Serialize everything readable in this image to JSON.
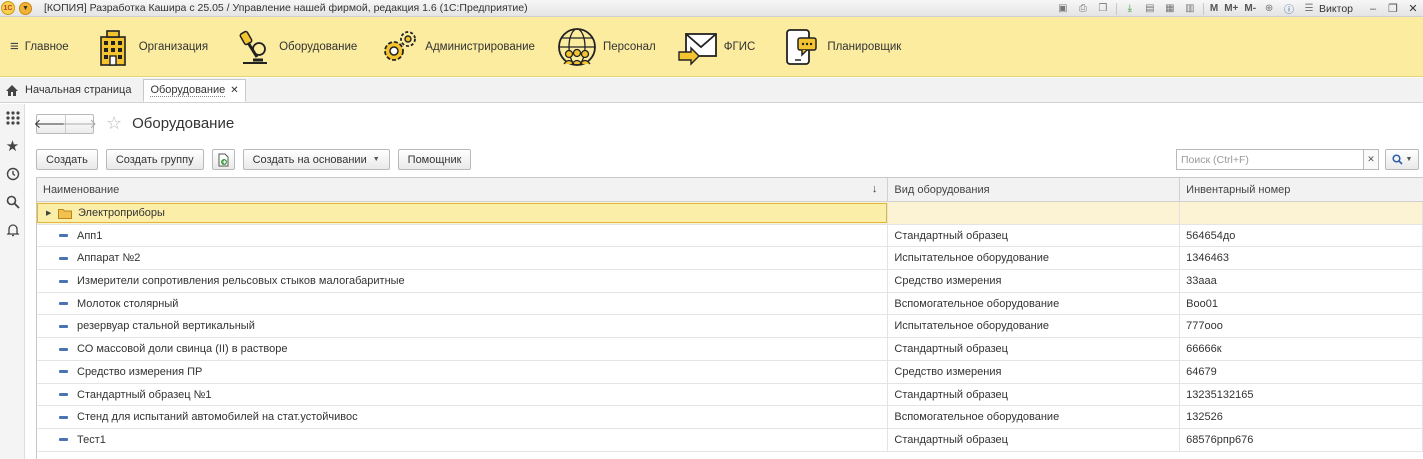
{
  "window": {
    "logo_text": "1С",
    "title": "[КОПИЯ] Разработка Кашира с 25.05 / Управление нашей фирмой, редакция 1.6  (1С:Предприятие)",
    "tools": {
      "m": "M",
      "m_plus": "M+",
      "m_minus": "M-"
    },
    "user": "Виктор"
  },
  "sections": {
    "main_label": "Главное",
    "items": [
      {
        "label": "Организация",
        "icon": "building-icon"
      },
      {
        "label": "Оборудование",
        "icon": "microscope-icon"
      },
      {
        "label": "Администрирование",
        "icon": "gears-icon"
      },
      {
        "label": "Персонал",
        "icon": "people-globe-icon"
      },
      {
        "label": "ФГИС",
        "icon": "mail-icon"
      },
      {
        "label": "Планировщик",
        "icon": "phone-chat-icon"
      }
    ]
  },
  "tabs": {
    "home": "Начальная страница",
    "active": "Оборудование"
  },
  "form": {
    "title": "Оборудование",
    "toolbar": {
      "create": "Создать",
      "create_group": "Создать группу",
      "create_based_on": "Создать на основании",
      "helper": "Помощник"
    },
    "search": {
      "placeholder": "Поиск (Ctrl+F)",
      "value": ""
    }
  },
  "table": {
    "columns": [
      "Наименование",
      "Вид оборудования",
      "Инвентарный номер"
    ],
    "group": {
      "name": "Электроприборы"
    },
    "rows": [
      {
        "name": "Апп1",
        "type": "Стандартный образец",
        "inv": "564654до"
      },
      {
        "name": "Аппарат №2",
        "type": "Испытательное оборудование",
        "inv": "1346463"
      },
      {
        "name": "Измерители сопротивления рельсовых стыков малогабаритные",
        "type": "Средство измерения",
        "inv": "33ааа"
      },
      {
        "name": "Молоток столярный",
        "type": "Вспомогательное оборудование",
        "inv": "Воо01"
      },
      {
        "name": "резервуар стальной вертикальный",
        "type": "Испытательное оборудование",
        "inv": "777ооо"
      },
      {
        "name": "СО массовой доли свинца (II) в растворе",
        "type": "Стандартный образец",
        "inv": "66666к"
      },
      {
        "name": "Средство измерения ПР",
        "type": "Средство измерения",
        "inv": "64679"
      },
      {
        "name": "Стандартный образец №1",
        "type": "Стандартный образец",
        "inv": "13235132165"
      },
      {
        "name": "Стенд для испытаний автомобилей на стат.устойчивос",
        "type": "Вспомогательное оборудование",
        "inv": "132526"
      },
      {
        "name": "Тест1",
        "type": "Стандартный образец",
        "inv": "68576рпр676"
      }
    ]
  },
  "colors": {
    "section_bg": "#fbeca0",
    "group_highlight": "#fbeea8",
    "accent_blue": "#4a73b5"
  }
}
